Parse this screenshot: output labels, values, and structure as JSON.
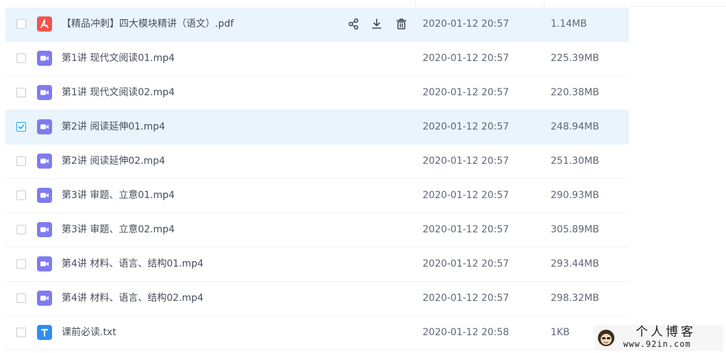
{
  "files": [
    {
      "name": "【精品冲刺】四大模块精讲（语文）.pdf",
      "date": "2020-01-12 20:57",
      "size": "1.14MB",
      "icon": "pdf-icon",
      "checked": false,
      "hover": true
    },
    {
      "name": "第1讲 现代文阅读01.mp4",
      "date": "2020-01-12 20:57",
      "size": "225.39MB",
      "icon": "video-icon",
      "checked": false
    },
    {
      "name": "第1讲 现代文阅读02.mp4",
      "date": "2020-01-12 20:57",
      "size": "220.38MB",
      "icon": "video-icon",
      "checked": false
    },
    {
      "name": "第2讲 阅读延伸01.mp4",
      "date": "2020-01-12 20:57",
      "size": "248.94MB",
      "icon": "video-icon",
      "checked": true
    },
    {
      "name": "第2讲 阅读延伸02.mp4",
      "date": "2020-01-12 20:57",
      "size": "251.30MB",
      "icon": "video-icon",
      "checked": false
    },
    {
      "name": "第3讲 审题、立意01.mp4",
      "date": "2020-01-12 20:57",
      "size": "290.93MB",
      "icon": "video-icon",
      "checked": false
    },
    {
      "name": "第3讲 审题、立意02.mp4",
      "date": "2020-01-12 20:57",
      "size": "305.89MB",
      "icon": "video-icon",
      "checked": false
    },
    {
      "name": "第4讲 材料、语言、结构01.mp4",
      "date": "2020-01-12 20:57",
      "size": "293.44MB",
      "icon": "video-icon",
      "checked": false
    },
    {
      "name": "第4讲 材料、语言、结构02.mp4",
      "date": "2020-01-12 20:57",
      "size": "298.32MB",
      "icon": "video-icon",
      "checked": false
    },
    {
      "name": "课前必读.txt",
      "date": "2020-01-12 20:58",
      "size": "1KB",
      "icon": "text-file-icon",
      "checked": false
    }
  ],
  "row_actions": [
    {
      "name": "share-icon"
    },
    {
      "name": "download-icon"
    },
    {
      "name": "delete-icon"
    }
  ],
  "watermark": {
    "title": "个人博客",
    "url": "www.92in.com"
  },
  "colors": {
    "row_highlight": "#e9f4fd",
    "checkbox_checked": "#06a7ff",
    "pdf_icon": "#f2544b",
    "video_icon": "#7f7bf0",
    "text_icon": "#2e8cf3"
  }
}
